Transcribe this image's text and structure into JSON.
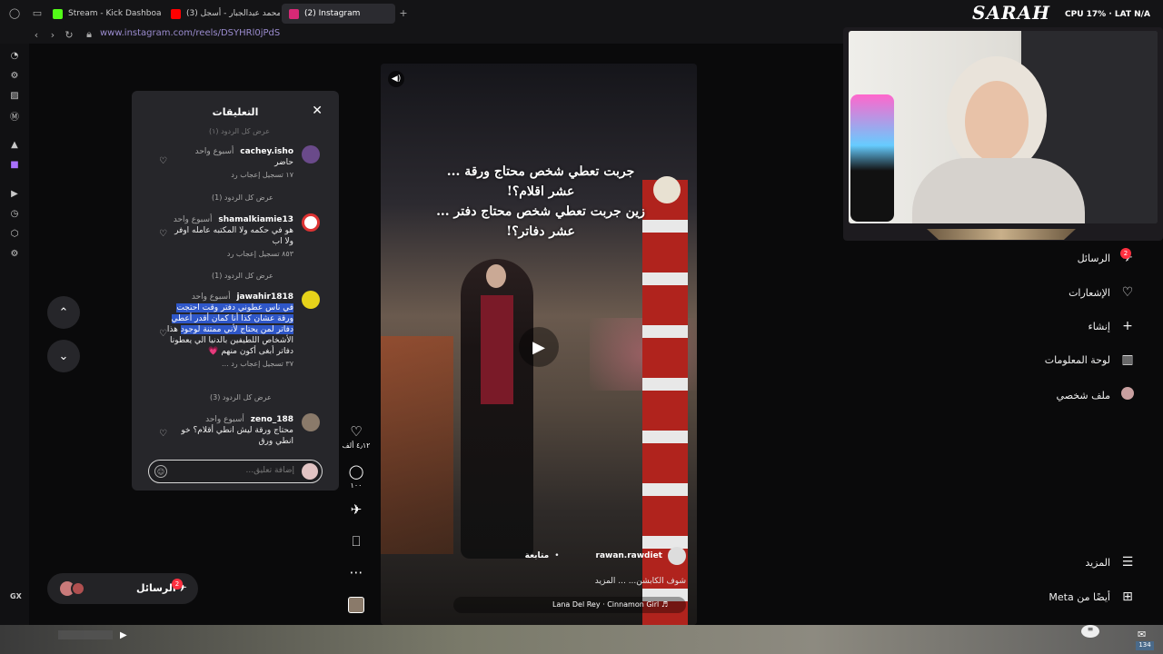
{
  "browser": {
    "tabs": [
      {
        "label": "Stream - Kick Dashboard",
        "icon_color": "#53fc18"
      },
      {
        "label": "(3) محمد عبدالجبار - أسجل",
        "icon_color": "#ff0000"
      },
      {
        "label": "(2) Instagram",
        "icon_color": "#d62976"
      }
    ],
    "new_tab": "+",
    "url": "www.instagram.com/reels/DSYHRl0jPdS"
  },
  "comments_panel": {
    "title": "التعليقات",
    "top_partial": "عرض كل الردود (١)",
    "comments": [
      {
        "username": "cachey.isho",
        "time": "أسبوع واحد",
        "text": "حاضر",
        "meta": "١٧ تسجيل إعجاب   رد",
        "replies": "عرض كل الردود (1)",
        "avatar_color": "#6a4a8a"
      },
      {
        "username": "shamalkiamie13",
        "time": "أسبوع واحد",
        "text": "هو في حكمه ولا المكتبه عامله اوفر ولا اب",
        "meta": "٨٥٣ تسجيل إعجاب   رد",
        "replies": "عرض كل الردود (1)",
        "avatar_color": "#d33"
      },
      {
        "username": "jawahir1818",
        "time": "أسبوع واحد",
        "text_highlighted": "في ناس عطوني دفتر وقت احتجت ورقة عشان كذا أنا كمان أقدر أعطي دفاتر لمن يحتاج لأني ممتنة لوجود",
        "text": "هذا الأشخاص اللطيفين بالدنيا الي يعطونا دفاتر أبغى أكون منهم 💗",
        "meta": "٣٧ تسجيل إعجاب   رد   ...",
        "replies": "عرض كل الردود (3)",
        "avatar_color": "#e6d21a"
      },
      {
        "username": "zeno_188",
        "time": "أسبوع واحد",
        "text": "محتاج ورقة ليش انطي أقلام؟ خو انطي ورق",
        "avatar_color": "#8a7a6a"
      }
    ],
    "input_placeholder": "إضافة تعليق..."
  },
  "reel": {
    "overlay_text": [
      "جربت تعطي شخص محتاج ورقة ...",
      "عشر اقلام؟!",
      "زين جربت تعطي شخص محتاج دفتر ...",
      "عشر دفاتر؟!"
    ],
    "username": "rawan.rawdiet",
    "follow": "متابعة",
    "separator": "•",
    "caption": "شوف الكابشن... ... المزيد",
    "audio": "Lana Del Rey · Cinnamon Girl ♬"
  },
  "actions": {
    "likes": "٤٫١٢ ألف",
    "comments": "١٠٠"
  },
  "right_nav": {
    "messages": "الرسائل",
    "messages_badge": "2",
    "notifications": "الإشعارات",
    "create": "إنشاء",
    "dashboard": "لوحة المعلومات",
    "profile": "ملف شخصي",
    "more": "المزيد",
    "meta": "أيضًا من Meta"
  },
  "messages_pill": {
    "label": "الرسائل",
    "badge": "2"
  },
  "overlay": {
    "brand": "SARAH",
    "stats": "CPU 17%  ·  LAT N/A"
  },
  "taskbar": {
    "mail_count": "134",
    "gx": "GX"
  }
}
